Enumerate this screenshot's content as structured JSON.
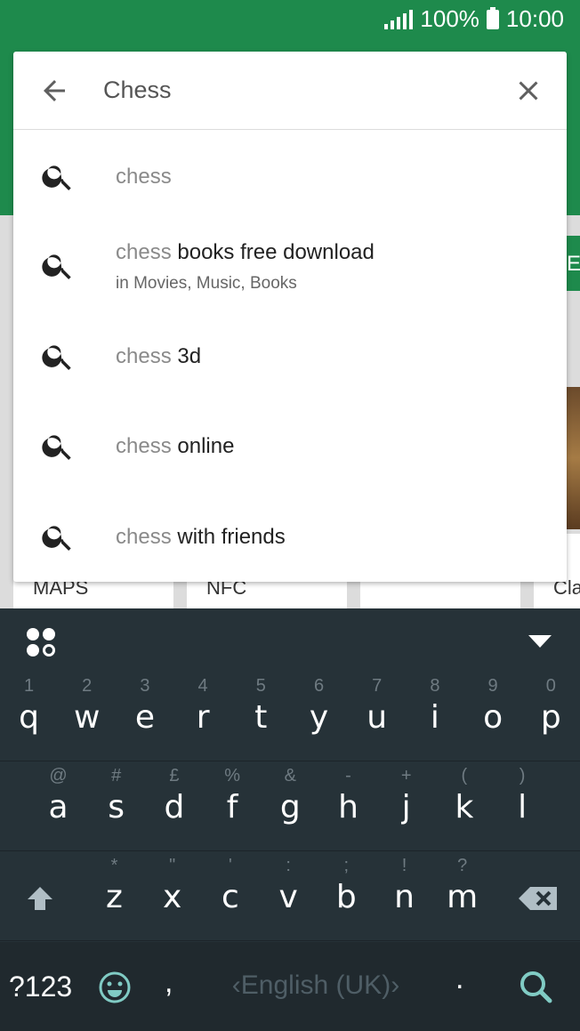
{
  "status_bar": {
    "signal_icon": "signal-icon",
    "battery": "100%",
    "battery_icon": "battery-icon",
    "time": "10:00"
  },
  "background": {
    "tab_fragment": "E",
    "cards": [
      "MAPS",
      "NFC",
      "",
      "Cla"
    ]
  },
  "search": {
    "query": "Chess",
    "back_icon": "arrow-back-icon",
    "clear_icon": "close-icon",
    "suggestions": [
      {
        "prefix": "chess",
        "rest": "",
        "sub": ""
      },
      {
        "prefix": "chess",
        "rest": " books free download",
        "sub": "in Movies, Music, Books"
      },
      {
        "prefix": "chess",
        "rest": " 3d",
        "sub": ""
      },
      {
        "prefix": "chess",
        "rest": " online",
        "sub": ""
      },
      {
        "prefix": "chess",
        "rest": " with friends",
        "sub": ""
      }
    ]
  },
  "keyboard": {
    "apps_icon": "keyboard-apps-icon",
    "hide_icon": "chevron-down-icon",
    "row1": [
      {
        "hint": "1",
        "key": "q"
      },
      {
        "hint": "2",
        "key": "w"
      },
      {
        "hint": "3",
        "key": "e"
      },
      {
        "hint": "4",
        "key": "r"
      },
      {
        "hint": "5",
        "key": "t"
      },
      {
        "hint": "6",
        "key": "y"
      },
      {
        "hint": "7",
        "key": "u"
      },
      {
        "hint": "8",
        "key": "i"
      },
      {
        "hint": "9",
        "key": "o"
      },
      {
        "hint": "0",
        "key": "p"
      }
    ],
    "row2": [
      {
        "hint": "@",
        "key": "a"
      },
      {
        "hint": "#",
        "key": "s"
      },
      {
        "hint": "£",
        "key": "d"
      },
      {
        "hint": "%",
        "key": "f"
      },
      {
        "hint": "&",
        "key": "g"
      },
      {
        "hint": "-",
        "key": "h"
      },
      {
        "hint": "+",
        "key": "j"
      },
      {
        "hint": "(",
        "key": "k"
      },
      {
        "hint": ")",
        "key": "l"
      }
    ],
    "row3": [
      {
        "hint": "*",
        "key": "z"
      },
      {
        "hint": "\"",
        "key": "x"
      },
      {
        "hint": "'",
        "key": "c"
      },
      {
        "hint": ":",
        "key": "v"
      },
      {
        "hint": ";",
        "key": "b"
      },
      {
        "hint": "!",
        "key": "n"
      },
      {
        "hint": "?",
        "key": "m"
      }
    ],
    "shift_icon": "shift-icon",
    "backspace_icon": "backspace-icon",
    "symbols_label": "?123",
    "emoji_icon": "emoji-icon",
    "comma": ",",
    "language": "English (UK)",
    "period": ".",
    "search_icon": "search-icon"
  },
  "colors": {
    "primary_green": "#1e8a4c",
    "keyboard_bg": "#263238",
    "accent_teal": "#80cbc4"
  }
}
